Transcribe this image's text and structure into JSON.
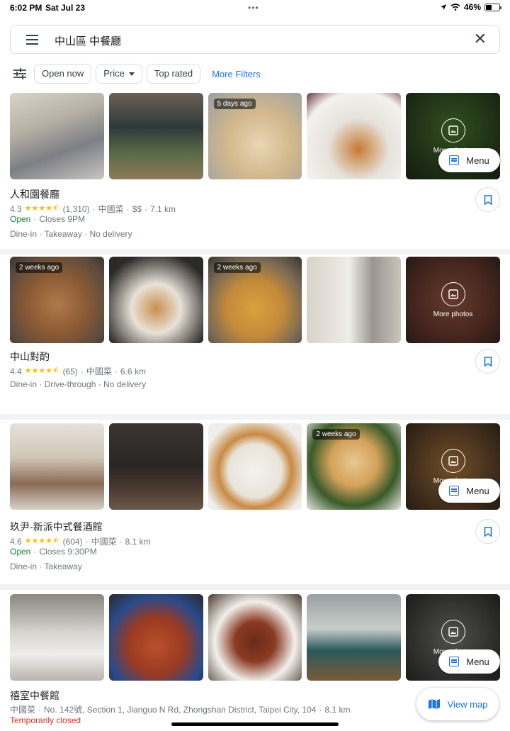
{
  "status_bar": {
    "time": "6:02 PM",
    "date": "Sat Jul 23",
    "dots": "•••",
    "battery": "46%",
    "battery_level": 0.46
  },
  "search": {
    "query": "中山區 中餐廳"
  },
  "filters": {
    "chips": [
      {
        "label": "Open now"
      },
      {
        "label": "Price"
      },
      {
        "label": "Top rated"
      }
    ],
    "more_filters": "More Filters"
  },
  "results": [
    {
      "name": "人和園餐廳",
      "rating": "4.3",
      "reviews": "(1,310)",
      "category": "中國菜",
      "price": "$$",
      "distance": "7.1 km",
      "status": "Open",
      "status_detail": "Closes 9PM",
      "services": "Dine-in · Takeaway · No delivery",
      "photo_tags": [
        "",
        "",
        "5 days ago",
        "",
        ""
      ],
      "more_photos": "More photos",
      "menu": "Menu"
    },
    {
      "name": "中山對酌",
      "rating": "4.4",
      "reviews": "(65)",
      "category": "中國菜",
      "distance": "6.6 km",
      "services": "Dine-in · Drive-through · No delivery",
      "photo_tags": [
        "2 weeks ago",
        "",
        "2 weeks ago",
        "",
        ""
      ],
      "more_photos": "More photos"
    },
    {
      "name": "玖尹-新派中式餐酒館",
      "rating": "4.6",
      "reviews": "(604)",
      "category": "中國菜",
      "distance": "8.1 km",
      "status": "Open",
      "status_detail": "Closes 9:30PM",
      "services": "Dine-in · Takeaway",
      "photo_tags": [
        "",
        "",
        "",
        "2 weeks ago",
        ""
      ],
      "more_photos": "More photos",
      "menu": "Menu"
    },
    {
      "name": "禧室中餐館",
      "category": "中國菜",
      "address": "No. 142號, Section 1, Jianguo N Rd, Zhongshan District, Taipei City, 104",
      "distance": "8.1 km",
      "status": "Temporarily closed",
      "more_photos": "More photos",
      "menu": "Menu"
    }
  ],
  "view_map": "View map",
  "colors": {
    "accent": "#1a73e8",
    "open": "#188038",
    "closed": "#d93025",
    "star": "#fbbc04"
  }
}
